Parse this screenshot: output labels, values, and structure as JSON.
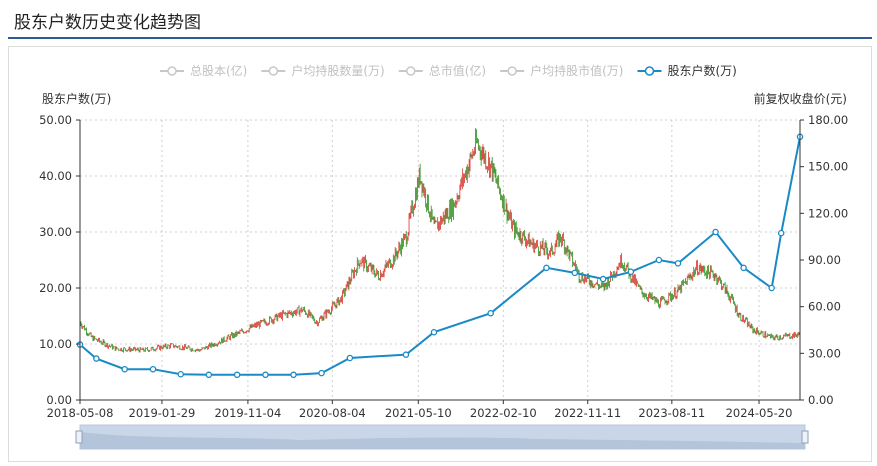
{
  "page": {
    "title": "股东户数历史变化趋势图"
  },
  "legend": [
    {
      "label": "总股本(亿)",
      "active": false
    },
    {
      "label": "户均持股数量(万)",
      "active": false
    },
    {
      "label": "总市值(亿)",
      "active": false
    },
    {
      "label": "户均持股市值(万)",
      "active": false
    },
    {
      "label": "股东户数(万)",
      "active": true
    }
  ],
  "colors": {
    "series": "#1a8ac6",
    "inactive": "#c8c8c8",
    "up": "#d9322b",
    "down": "#2b8f1f",
    "grid": "#cfcfcf",
    "slider": "#c9d6e8"
  },
  "chart_data": {
    "type": "line",
    "left_axis": {
      "title": "股东户数(万)",
      "range": [
        0,
        50
      ],
      "ticks": [
        "0.00",
        "10.00",
        "20.00",
        "30.00",
        "40.00",
        "50.00"
      ]
    },
    "right_axis": {
      "title": "前复权收盘价(元)",
      "range": [
        0,
        180
      ],
      "ticks": [
        "0.00",
        "30.00",
        "60.00",
        "90.00",
        "120.00",
        "150.00",
        "180.00"
      ]
    },
    "x_axis": {
      "ticks": [
        "2018-05-08",
        "2019-01-29",
        "2019-11-04",
        "2020-08-04",
        "2021-05-10",
        "2022-02-10",
        "2022-11-11",
        "2023-08-11",
        "2024-05-20"
      ],
      "start": "2018-05-08",
      "end": "2024-09-30"
    },
    "grid": true,
    "series": [
      {
        "name": "股东户数(万)",
        "points": [
          {
            "x": "2018-05-08",
            "y": 9.9
          },
          {
            "x": "2018-06-30",
            "y": 7.4
          },
          {
            "x": "2018-09-30",
            "y": 5.5
          },
          {
            "x": "2018-12-31",
            "y": 5.5
          },
          {
            "x": "2019-03-31",
            "y": 4.6
          },
          {
            "x": "2019-06-30",
            "y": 4.5
          },
          {
            "x": "2019-09-30",
            "y": 4.5
          },
          {
            "x": "2019-12-31",
            "y": 4.5
          },
          {
            "x": "2020-03-31",
            "y": 4.5
          },
          {
            "x": "2020-06-30",
            "y": 4.8
          },
          {
            "x": "2020-09-30",
            "y": 7.5
          },
          {
            "x": "2021-03-31",
            "y": 8.1
          },
          {
            "x": "2021-06-30",
            "y": 12.1
          },
          {
            "x": "2021-12-31",
            "y": 15.5
          },
          {
            "x": "2022-06-30",
            "y": 23.6
          },
          {
            "x": "2022-09-30",
            "y": 22.7
          },
          {
            "x": "2022-12-31",
            "y": 21.6
          },
          {
            "x": "2023-03-31",
            "y": 22.9
          },
          {
            "x": "2023-06-30",
            "y": 25.0
          },
          {
            "x": "2023-08-31",
            "y": 24.4
          },
          {
            "x": "2023-12-31",
            "y": 30.0
          },
          {
            "x": "2024-03-31",
            "y": 23.6
          },
          {
            "x": "2024-06-30",
            "y": 20.0
          },
          {
            "x": "2024-07-31",
            "y": 29.8
          },
          {
            "x": "2024-09-30",
            "y": 47.0
          }
        ]
      },
      {
        "name": "前复权收盘价(元)",
        "axis": "right",
        "type": "candlestick",
        "anchors": [
          {
            "x": "2018-05-08",
            "y": 50
          },
          {
            "x": "2018-06-15",
            "y": 40
          },
          {
            "x": "2018-09-01",
            "y": 33
          },
          {
            "x": "2018-12-01",
            "y": 32
          },
          {
            "x": "2019-03-01",
            "y": 35
          },
          {
            "x": "2019-06-01",
            "y": 32
          },
          {
            "x": "2019-09-01",
            "y": 40
          },
          {
            "x": "2019-12-01",
            "y": 48
          },
          {
            "x": "2020-03-01",
            "y": 55
          },
          {
            "x": "2020-05-01",
            "y": 58
          },
          {
            "x": "2020-06-15",
            "y": 50
          },
          {
            "x": "2020-09-01",
            "y": 65
          },
          {
            "x": "2020-11-01",
            "y": 90
          },
          {
            "x": "2021-01-01",
            "y": 80
          },
          {
            "x": "2021-02-15",
            "y": 90
          },
          {
            "x": "2021-04-01",
            "y": 105
          },
          {
            "x": "2021-05-15",
            "y": 145
          },
          {
            "x": "2021-07-01",
            "y": 110
          },
          {
            "x": "2021-09-01",
            "y": 125
          },
          {
            "x": "2021-11-15",
            "y": 165
          },
          {
            "x": "2022-01-01",
            "y": 150
          },
          {
            "x": "2022-03-15",
            "y": 110
          },
          {
            "x": "2022-05-15",
            "y": 100
          },
          {
            "x": "2022-07-15",
            "y": 95
          },
          {
            "x": "2022-08-15",
            "y": 105
          },
          {
            "x": "2022-10-15",
            "y": 80
          },
          {
            "x": "2023-01-01",
            "y": 72
          },
          {
            "x": "2023-03-01",
            "y": 90
          },
          {
            "x": "2023-05-01",
            "y": 70
          },
          {
            "x": "2023-07-01",
            "y": 62
          },
          {
            "x": "2023-09-01",
            "y": 70
          },
          {
            "x": "2023-11-01",
            "y": 85
          },
          {
            "x": "2024-01-01",
            "y": 80
          },
          {
            "x": "2024-02-20",
            "y": 65
          },
          {
            "x": "2024-03-15",
            "y": 55
          },
          {
            "x": "2024-05-01",
            "y": 45
          },
          {
            "x": "2024-07-01",
            "y": 40
          },
          {
            "x": "2024-09-30",
            "y": 42
          }
        ]
      }
    ]
  }
}
